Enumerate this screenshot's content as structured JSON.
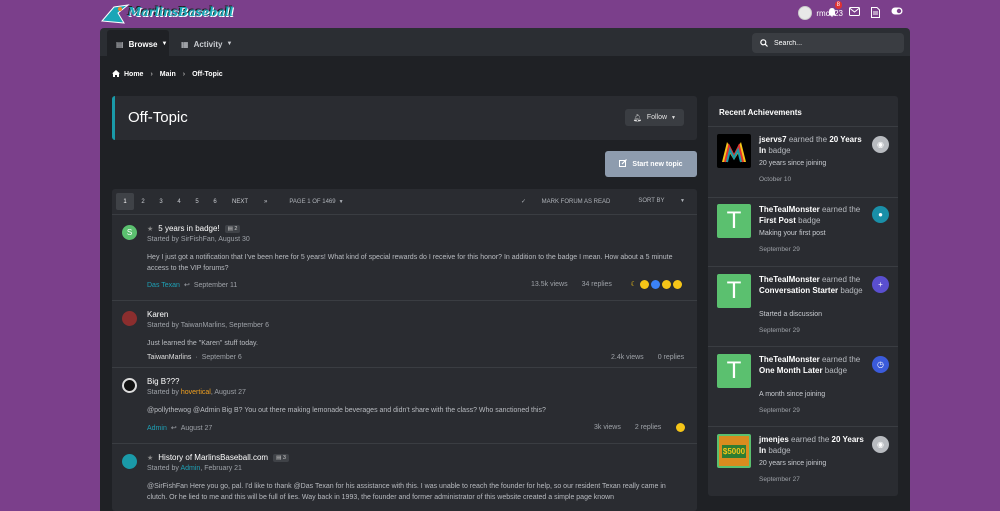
{
  "header": {
    "logo_text": "MarlinsBaseball",
    "username": "rmc523",
    "alerts_count": "8"
  },
  "nav": {
    "tabs": [
      {
        "label": "Browse"
      },
      {
        "label": "Activity"
      }
    ],
    "search_placeholder": "Search..."
  },
  "breadcrumb": [
    "Home",
    "Main",
    "Off-Topic"
  ],
  "forum": {
    "title": "Off-Topic",
    "follow_label": "Follow",
    "start_topic_label": "Start new topic"
  },
  "pager": {
    "pages": [
      "1",
      "2",
      "3",
      "4",
      "5",
      "6"
    ],
    "next": "NEXT",
    "last": "»",
    "page_label": "PAGE 1 OF 1469",
    "mark_read": "MARK FORUM AS READ",
    "sort": "SORT BY"
  },
  "threads": [
    {
      "title": "5 years in badge!",
      "pages_badge": "2",
      "starter": "SirFishFan",
      "date": "August 30",
      "excerpt": "Hey I just got a notification that I've been here for 5 years! What kind of special rewards do I receive for this honor? In addition to the badge I mean. How about a 5 minute access to the VIP forums?",
      "last_poster": "Das Texan",
      "last_date": "September 11",
      "views": "13.5k views",
      "replies": "34 replies"
    },
    {
      "title": "Karen",
      "starter": "TaiwanMarlins",
      "date": "September 6",
      "excerpt": "Just learned the \"Karen\" stuff today.",
      "last_poster": "TaiwanMarlins",
      "last_date": "September 6",
      "views": "2.4k views",
      "replies": "0 replies"
    },
    {
      "title": "Big B???",
      "starter": "hovertical",
      "date": "August 27",
      "excerpt": "@pollythewog @Admin Big B? You out there making lemonade beverages and didn't share with the class? Who sanctioned this?",
      "last_poster": "Admin",
      "last_date": "August 27",
      "views": "3k views",
      "replies": "2 replies"
    },
    {
      "title": "History of MarlinsBaseball.com",
      "pages_badge": "3",
      "starter": "Admin",
      "date": "February 21",
      "excerpt": "@SirFishFan Here you go, pal. I'd like to thank @Das Texan for his assistance with this. I was unable to reach the founder for help, so our resident Texan really came in clutch. Or he lied to me and this will be full of lies. Way back in 1993, the founder and former administrator of this website created a simple page known"
    }
  ],
  "sidebar": {
    "title": "Recent Achievements",
    "earned": "earned the",
    "suffix": "badge",
    "items": [
      {
        "user": "jservs7",
        "badge": "20 Years In",
        "desc": "20 years since joining",
        "date": "October 10"
      },
      {
        "user": "TheTealMonster",
        "badge": "First Post",
        "desc": "Making your first post",
        "date": "September 29",
        "initial": "T"
      },
      {
        "user": "TheTealMonster",
        "badge": "Conversation Starter",
        "desc": "Started a discussion",
        "date": "September 29",
        "initial": "T"
      },
      {
        "user": "TheTealMonster",
        "badge": "One Month Later",
        "desc": "A month since joining",
        "date": "September 29",
        "initial": "T"
      },
      {
        "user": "jmenjes",
        "badge": "20 Years In",
        "desc": "20 years since joining",
        "date": "September 27",
        "avatar_text": "$5000"
      }
    ]
  },
  "colors": {
    "page_bg": "#7b3f8b",
    "panel_bg": "#1f2125",
    "card_bg": "#2a2c31",
    "accent_teal": "#1a9aa8",
    "avatar_green": "#5bc06f",
    "start_btn": "#8e9cae"
  }
}
